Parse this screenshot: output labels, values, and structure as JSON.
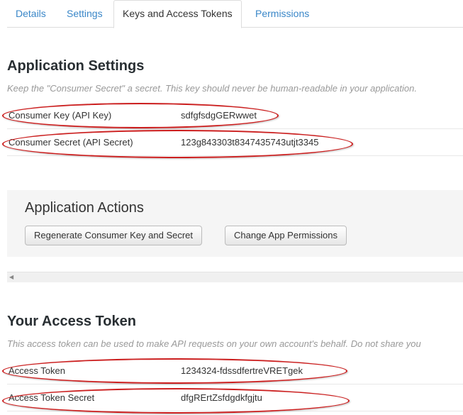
{
  "tabs": [
    {
      "label": "Details"
    },
    {
      "label": "Settings"
    },
    {
      "label": "Keys and Access Tokens"
    },
    {
      "label": "Permissions"
    }
  ],
  "application_settings": {
    "title": "Application Settings",
    "subtitle": "Keep the \"Consumer Secret\" a secret. This key should never be human-readable in your application.",
    "rows": [
      {
        "label": "Consumer Key (API Key)",
        "value": "sdfgfsdgGERwwet"
      },
      {
        "label": "Consumer Secret (API Secret)",
        "value": "123g843303t8347435743utjt3345"
      }
    ]
  },
  "application_actions": {
    "title": "Application Actions",
    "regenerate_label": "Regenerate Consumer Key and Secret",
    "change_permissions_label": "Change App Permissions"
  },
  "access_token": {
    "title": "Your Access Token",
    "subtitle": "This access token can be used to make API requests on your own account's behalf. Do not share you",
    "rows": [
      {
        "label": "Access Token",
        "value": "1234324-fdssdfertreVRETgek"
      },
      {
        "label": "Access Token Secret",
        "value": "dfgRErtZsfdgdkfgjtu"
      }
    ]
  },
  "colors": {
    "link": "#3a87c8",
    "annotation": "#cc1f1f",
    "panel_bg": "#f5f5f5"
  },
  "icons": {
    "scroll_left": "triangle-left-icon"
  }
}
